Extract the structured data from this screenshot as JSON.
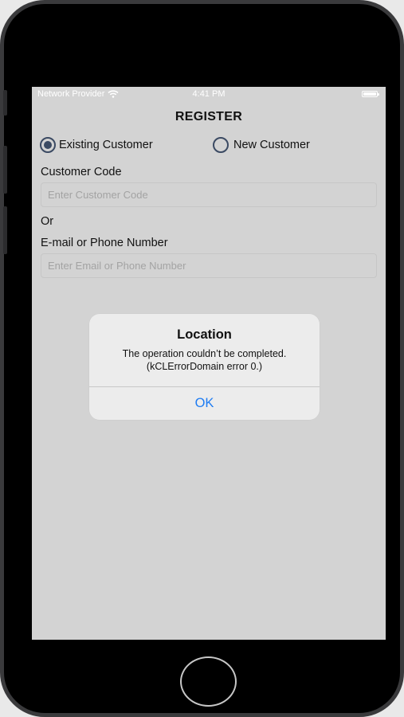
{
  "status_bar": {
    "carrier": "Network Provider",
    "time": "4:41 PM",
    "wifi_icon": "wifi-icon",
    "battery_icon": "battery-icon"
  },
  "screen": {
    "title": "REGISTER",
    "customer_type": {
      "options": [
        {
          "label": "Existing Customer",
          "selected": true
        },
        {
          "label": "New Customer",
          "selected": false
        }
      ]
    },
    "customer_code": {
      "label": "Customer Code",
      "value": "",
      "placeholder": "Enter Customer Code"
    },
    "or_text": "Or",
    "email_phone": {
      "label": "E-mail or Phone Number",
      "value": "",
      "placeholder": "Enter Email or Phone Number"
    }
  },
  "alert": {
    "title": "Location",
    "message_line1": "The operation couldn’t be completed.",
    "message_line2": "(kCLErrorDomain error 0.)",
    "ok_label": "OK"
  },
  "colors": {
    "radio": "#3b4a63",
    "alert_button": "#1e7cf2",
    "screen_bg": "#d3d3d3"
  }
}
